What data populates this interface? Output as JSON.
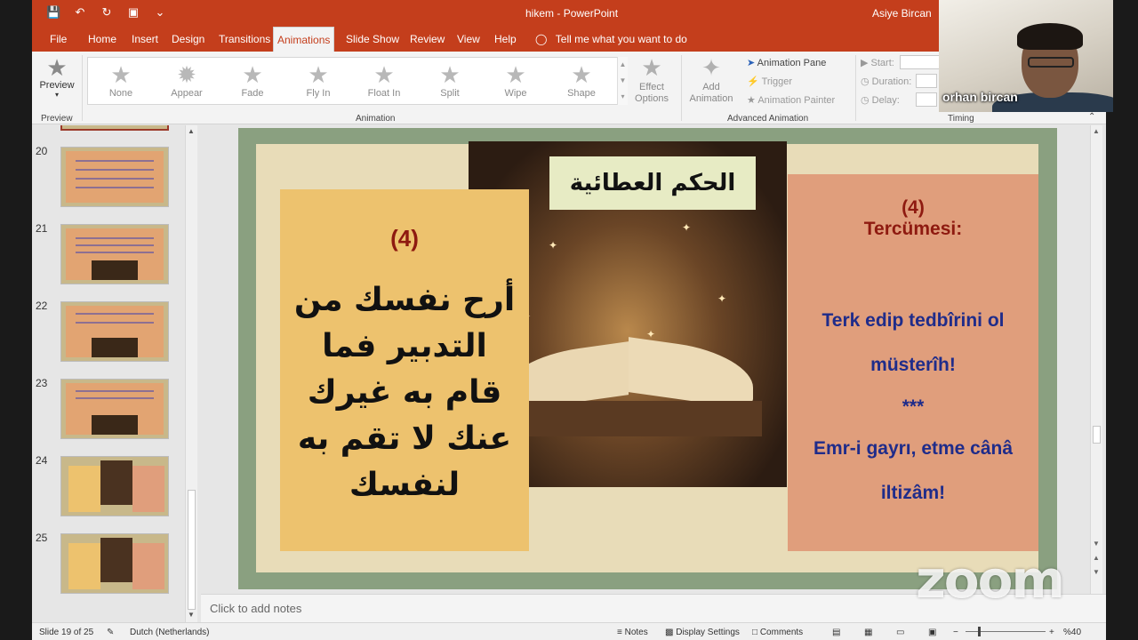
{
  "app": {
    "doc_title": "hikem",
    "app_name": "PowerPoint",
    "user": "Asiye Bircan"
  },
  "menu": {
    "file": "File",
    "tabs": [
      "Home",
      "Insert",
      "Design",
      "Transitions",
      "Animations",
      "Slide Show",
      "Review",
      "View",
      "Help"
    ],
    "active_tab": "Animations",
    "tellme": "Tell me what you want to do"
  },
  "ribbon": {
    "preview": {
      "label": "Preview",
      "group": "Preview"
    },
    "animations": [
      "None",
      "Appear",
      "Fade",
      "Fly In",
      "Float In",
      "Split",
      "Wipe",
      "Shape"
    ],
    "effect_options": "Effect Options",
    "animation_group": "Animation",
    "add_animation": "Add Animation",
    "animation_pane": "Animation Pane",
    "trigger": "Trigger",
    "animation_painter": "Animation Painter",
    "advanced_group": "Advanced Animation",
    "start": "Start:",
    "duration": "Duration:",
    "delay": "Delay:",
    "timing_group": "Timing"
  },
  "thumbnails": [
    "20",
    "21",
    "22",
    "23",
    "24",
    "25"
  ],
  "slide": {
    "title": "الحكم العطائية",
    "left_number": "(4)",
    "arabic_text": "أرح نفسك من التدبير فما قام به غيرك عنك لا تقم به لنفسك",
    "right_number": "(4)",
    "right_label": "Tercümesi:",
    "translation_1": "Terk edip tedbîrini ol müsterîh!",
    "stars": "***",
    "translation_2": "Emr-i gayrı, etme cânâ iltizâm!"
  },
  "notes": {
    "placeholder": "Click to add notes"
  },
  "status": {
    "slide_info": "Slide 19 of 25",
    "language": "Dutch (Netherlands)",
    "notes": "Notes",
    "display_settings": "Display Settings",
    "comments": "Comments",
    "zoom_level": "%40"
  },
  "video": {
    "participant_name": "orhan bircan",
    "watermark": "zoom"
  }
}
